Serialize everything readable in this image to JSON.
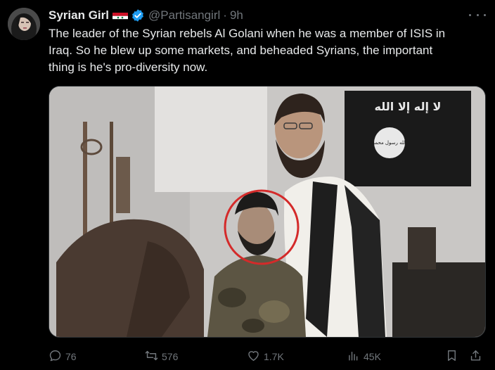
{
  "tweet": {
    "author": {
      "display_name": "Syrian Girl",
      "handle": "@Partisangirl",
      "separator": "·",
      "time": "9h",
      "verified": true,
      "flag_icon": "syria-flag-icon"
    },
    "text_lines": [
      "The leader of the Syrian rebels Al Golani when he was a member of ISIS in",
      "Iraq. So he blew up some markets, and beheaded Syrians, the important",
      "thing is he's pro-diversity now."
    ],
    "media": {
      "banner_text": "لا إله إلا الله",
      "seal_text": "الله رسول محمد"
    },
    "stats": {
      "replies": "76",
      "reposts": "576",
      "likes": "1.7K",
      "views": "45K"
    }
  },
  "icons": {
    "reply": "reply-icon",
    "repost": "repost-icon",
    "like": "like-icon",
    "views": "views-icon",
    "bookmark": "bookmark-icon",
    "share": "share-icon",
    "more": "more-icon",
    "verified": "verified-icon"
  },
  "colors": {
    "background": "#000000",
    "text": "#e7e9ea",
    "muted": "#71767b",
    "verified": "#1d9bf0",
    "highlight_circle": "#d42a2a"
  }
}
